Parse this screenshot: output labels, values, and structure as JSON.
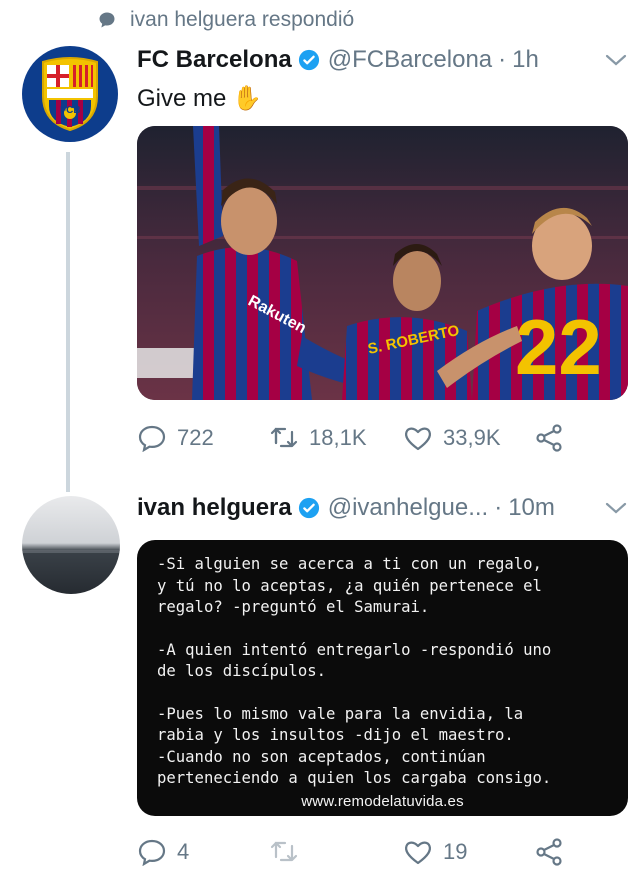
{
  "context": {
    "text": "ivan helguera respondió",
    "icon": "reply-bubble-icon"
  },
  "tweet1": {
    "name": "FC Barcelona",
    "handle": "@FCBarcelona",
    "separator": "·",
    "time": "1h",
    "text": "Give me",
    "emoji": "✋",
    "avatar_text": "FCB",
    "photo": {
      "player_back_name": "S. ROBERTO",
      "player_number": "22",
      "sponsor": "Rakuten"
    },
    "actions": {
      "replies": "722",
      "retweets": "18,1K",
      "likes": "33,9K"
    }
  },
  "tweet2": {
    "name": "ivan helguera",
    "handle": "@ivanhelgue...",
    "separator": "·",
    "time": "10m",
    "quote_lines": [
      "-Si alguien se acerca a ti con un regalo,",
      "y tú no lo aceptas, ¿a quién pertenece el",
      "regalo? -preguntó el Samurai.",
      "",
      "-A quien intentó entregarlo -respondió uno",
      "de los discípulos.",
      "",
      "-Pues lo mismo vale para la envidia, la",
      "rabia y los insultos -dijo el maestro.",
      "-Cuando no son aceptados, continúan",
      "perteneciendo a quien los cargaba consigo."
    ],
    "quote_url": "www.remodelatuvida.es",
    "actions": {
      "replies": "4",
      "retweets": "",
      "likes": "19"
    }
  },
  "colors": {
    "accent": "#1da1f2",
    "muted": "#657786",
    "line": "#ccd6dd",
    "barca_blue": "#0d3d8c",
    "barca_red": "#a50044"
  }
}
